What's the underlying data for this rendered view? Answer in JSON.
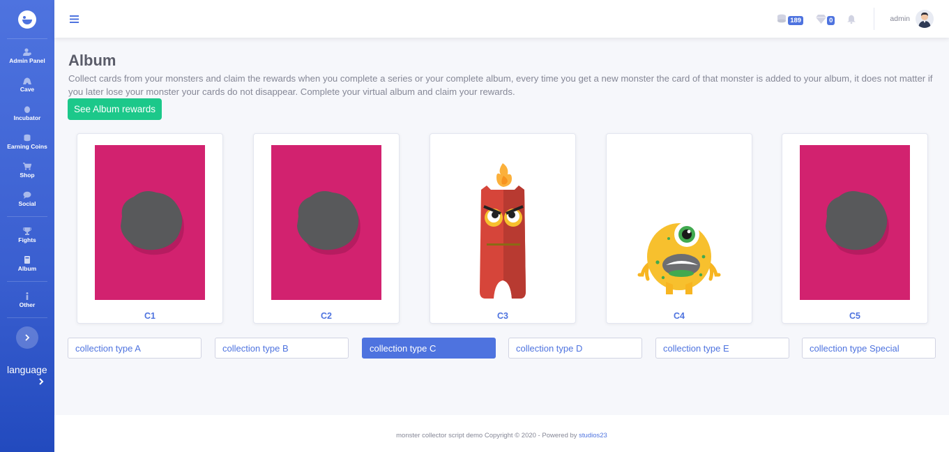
{
  "sidebar": {
    "items": [
      {
        "label": "Admin Panel",
        "icon": "users-cog-icon"
      },
      {
        "label": "Cave",
        "icon": "cave-icon"
      },
      {
        "label": "Incubator",
        "icon": "egg-icon"
      },
      {
        "label": "Earning Coins",
        "icon": "coins-icon"
      },
      {
        "label": "Shop",
        "icon": "cart-icon"
      },
      {
        "label": "Social",
        "icon": "comment-icon"
      },
      {
        "label": "Fights",
        "icon": "trophy-icon"
      },
      {
        "label": "Album",
        "icon": "book-icon"
      },
      {
        "label": "Other",
        "icon": "info-icon"
      }
    ],
    "language_label": "language"
  },
  "topbar": {
    "coins_count": "189",
    "gems_count": "0",
    "username": "admin"
  },
  "album": {
    "title": "Album",
    "description": "Collect cards from your monsters and claim the rewards when you complete a series or your complete album, every time you get a new monster the card of that monster is added to your album, it does not matter if you later lose your monster your cards do not disappear. Complete your virtual album and claim your rewards.",
    "rewards_button": "See Album rewards",
    "cards": [
      {
        "label": "C1",
        "state": "locked"
      },
      {
        "label": "C2",
        "state": "locked"
      },
      {
        "label": "C3",
        "state": "unlocked"
      },
      {
        "label": "C4",
        "state": "unlocked"
      },
      {
        "label": "C5",
        "state": "locked"
      }
    ],
    "collections": [
      {
        "label": "collection type A",
        "active": false
      },
      {
        "label": "collection type B",
        "active": false
      },
      {
        "label": "collection type C",
        "active": true
      },
      {
        "label": "collection type D",
        "active": false
      },
      {
        "label": "collection type E",
        "active": false
      },
      {
        "label": "collection type Special",
        "active": false
      }
    ]
  },
  "footer": {
    "text": "monster collector script demo Copyright © 2020 - Powered by",
    "link": "studios23"
  },
  "colors": {
    "primary": "#4e73df",
    "success": "#1cc88a",
    "card_locked_bg": "#d2226f",
    "silhouette": "#58595b"
  }
}
